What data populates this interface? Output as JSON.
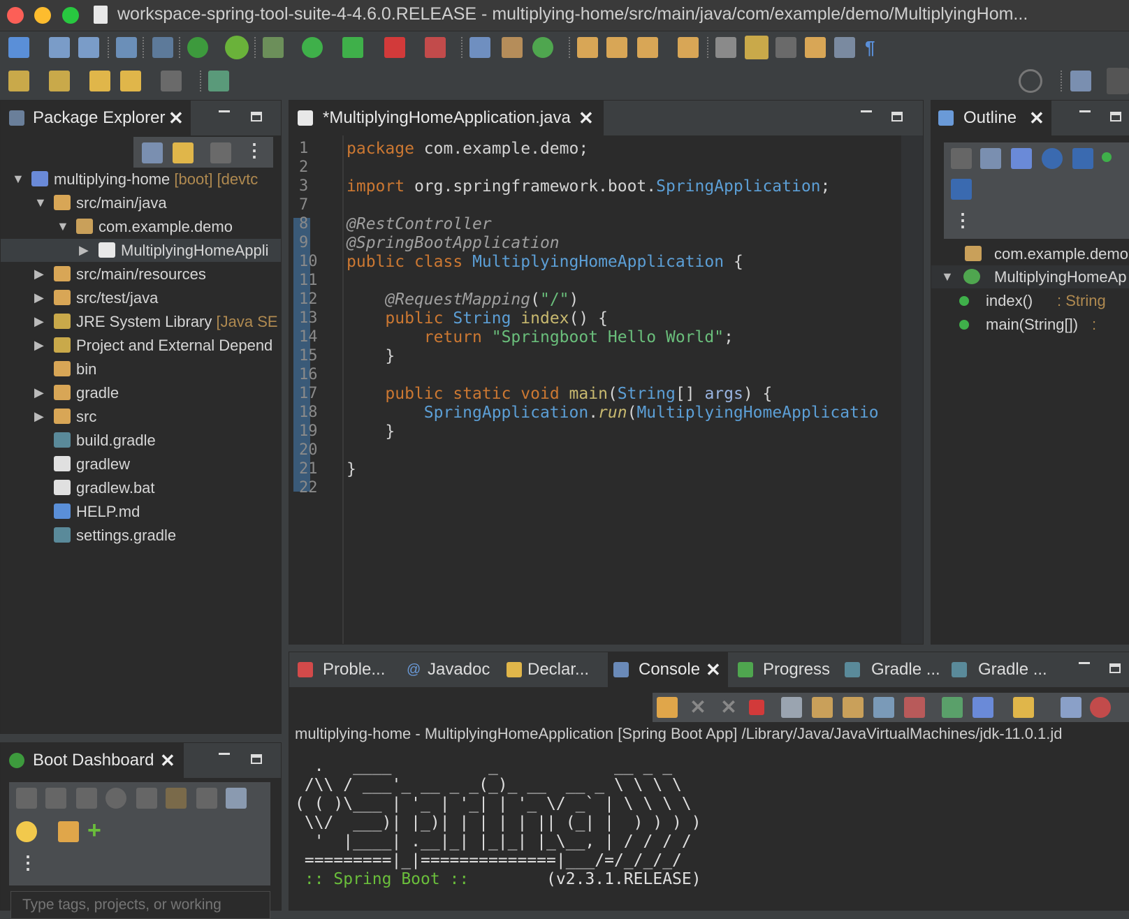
{
  "window": {
    "title": "workspace-spring-tool-suite-4-4.6.0.RELEASE - multiplying-home/src/main/java/com/example/demo/MultiplyingHom..."
  },
  "package_explorer": {
    "tab_label": "Package Explorer",
    "tree": [
      {
        "label": "multiplying-home",
        "decoration": " [boot] [devtc",
        "level": 0,
        "twisty": "expanded",
        "icon": "project-icon"
      },
      {
        "label": "src/main/java",
        "decoration": "",
        "level": 1,
        "twisty": "expanded",
        "icon": "source-folder-icon"
      },
      {
        "label": "com.example.demo",
        "decoration": "",
        "level": 2,
        "twisty": "expanded",
        "icon": "package-icon"
      },
      {
        "label": "MultiplyingHomeAppli",
        "decoration": "",
        "level": 3,
        "twisty": "collapsed",
        "icon": "java-file-icon",
        "selected": true
      },
      {
        "label": "src/main/resources",
        "decoration": "",
        "level": 1,
        "twisty": "collapsed",
        "icon": "source-folder-icon"
      },
      {
        "label": "src/test/java",
        "decoration": "",
        "level": 1,
        "twisty": "collapsed",
        "icon": "source-folder-icon"
      },
      {
        "label": "JRE System Library",
        "decoration": " [Java SE",
        "level": 1,
        "twisty": "collapsed",
        "icon": "library-icon"
      },
      {
        "label": "Project and External Depend",
        "decoration": "",
        "level": 1,
        "twisty": "collapsed",
        "icon": "library-icon"
      },
      {
        "label": "bin",
        "decoration": "",
        "level": 1,
        "twisty": "none",
        "icon": "folder-icon"
      },
      {
        "label": "gradle",
        "decoration": "",
        "level": 1,
        "twisty": "collapsed",
        "icon": "folder-icon"
      },
      {
        "label": "src",
        "decoration": "",
        "level": 1,
        "twisty": "collapsed",
        "icon": "folder-icon"
      },
      {
        "label": "build.gradle",
        "decoration": "",
        "level": 1,
        "twisty": "none",
        "icon": "gradle-file-icon"
      },
      {
        "label": "gradlew",
        "decoration": "",
        "level": 1,
        "twisty": "none",
        "icon": "text-file-icon"
      },
      {
        "label": "gradlew.bat",
        "decoration": "",
        "level": 1,
        "twisty": "none",
        "icon": "text-file-icon"
      },
      {
        "label": "HELP.md",
        "decoration": "",
        "level": 1,
        "twisty": "none",
        "icon": "markdown-file-icon"
      },
      {
        "label": "settings.gradle",
        "decoration": "",
        "level": 1,
        "twisty": "none",
        "icon": "gradle-file-icon"
      }
    ]
  },
  "boot_dashboard": {
    "tab_label": "Boot Dashboard",
    "filter_placeholder": "Type tags, projects, or working"
  },
  "editor": {
    "tab_label": "*MultiplyingHomeApplication.java",
    "lines": [
      {
        "n": "1",
        "t": "package com.example.demo;"
      },
      {
        "n": "2",
        "t": ""
      },
      {
        "n": "3",
        "t": "import org.springframework.boot.SpringApplication;"
      },
      {
        "n": "7",
        "t": ""
      },
      {
        "n": "8",
        "t": "@RestController"
      },
      {
        "n": "9",
        "t": "@SpringBootApplication"
      },
      {
        "n": "10",
        "t": "public class MultiplyingHomeApplication {"
      },
      {
        "n": "11",
        "t": ""
      },
      {
        "n": "12",
        "t": "    @RequestMapping(\"/\")"
      },
      {
        "n": "13",
        "t": "    public String index() {"
      },
      {
        "n": "14",
        "t": "        return \"Springboot Hello World\";"
      },
      {
        "n": "15",
        "t": "    }"
      },
      {
        "n": "16",
        "t": ""
      },
      {
        "n": "17",
        "t": "    public static void main(String[] args) {"
      },
      {
        "n": "18",
        "t": "        SpringApplication.run(MultiplyingHomeApplicatio"
      },
      {
        "n": "19",
        "t": "    }"
      },
      {
        "n": "20",
        "t": ""
      },
      {
        "n": "21",
        "t": "}"
      },
      {
        "n": "22",
        "t": ""
      }
    ]
  },
  "outline": {
    "tab_label": "Outline",
    "items": [
      {
        "label": "com.example.demo",
        "suffix": ""
      },
      {
        "label": "MultiplyingHomeAp",
        "suffix": ""
      },
      {
        "label": "index()",
        "suffix": " : String"
      },
      {
        "label": "main(String[])",
        "suffix": " :"
      }
    ]
  },
  "bottom_tabs": {
    "problems": "Proble...",
    "javadoc": "Javadoc",
    "declaration": "Declar...",
    "console": "Console",
    "progress": "Progress",
    "gradle1": "Gradle ...",
    "gradle2": "Gradle ..."
  },
  "console": {
    "header": "multiplying-home - MultiplyingHomeApplication [Spring Boot App] /Library/Java/JavaVirtualMachines/jdk-11.0.1.jd",
    "banner": [
      "  .   ____          _            __ _ _",
      " /\\\\ / ___'_ __ _ _(_)_ __  __ _ \\ \\ \\ \\",
      "( ( )\\___ | '_ | '_| | '_ \\/ _` | \\ \\ \\ \\",
      " \\\\/  ___)| |_)| | | | | || (_| |  ) ) ) )",
      "  '  |____| .__|_| |_|_| |_\\__, | / / / /",
      " =========|_|==============|___/=/_/_/_/"
    ],
    "footer_left": " :: Spring Boot ::",
    "footer_right": "        (v2.3.1.RELEASE)"
  }
}
